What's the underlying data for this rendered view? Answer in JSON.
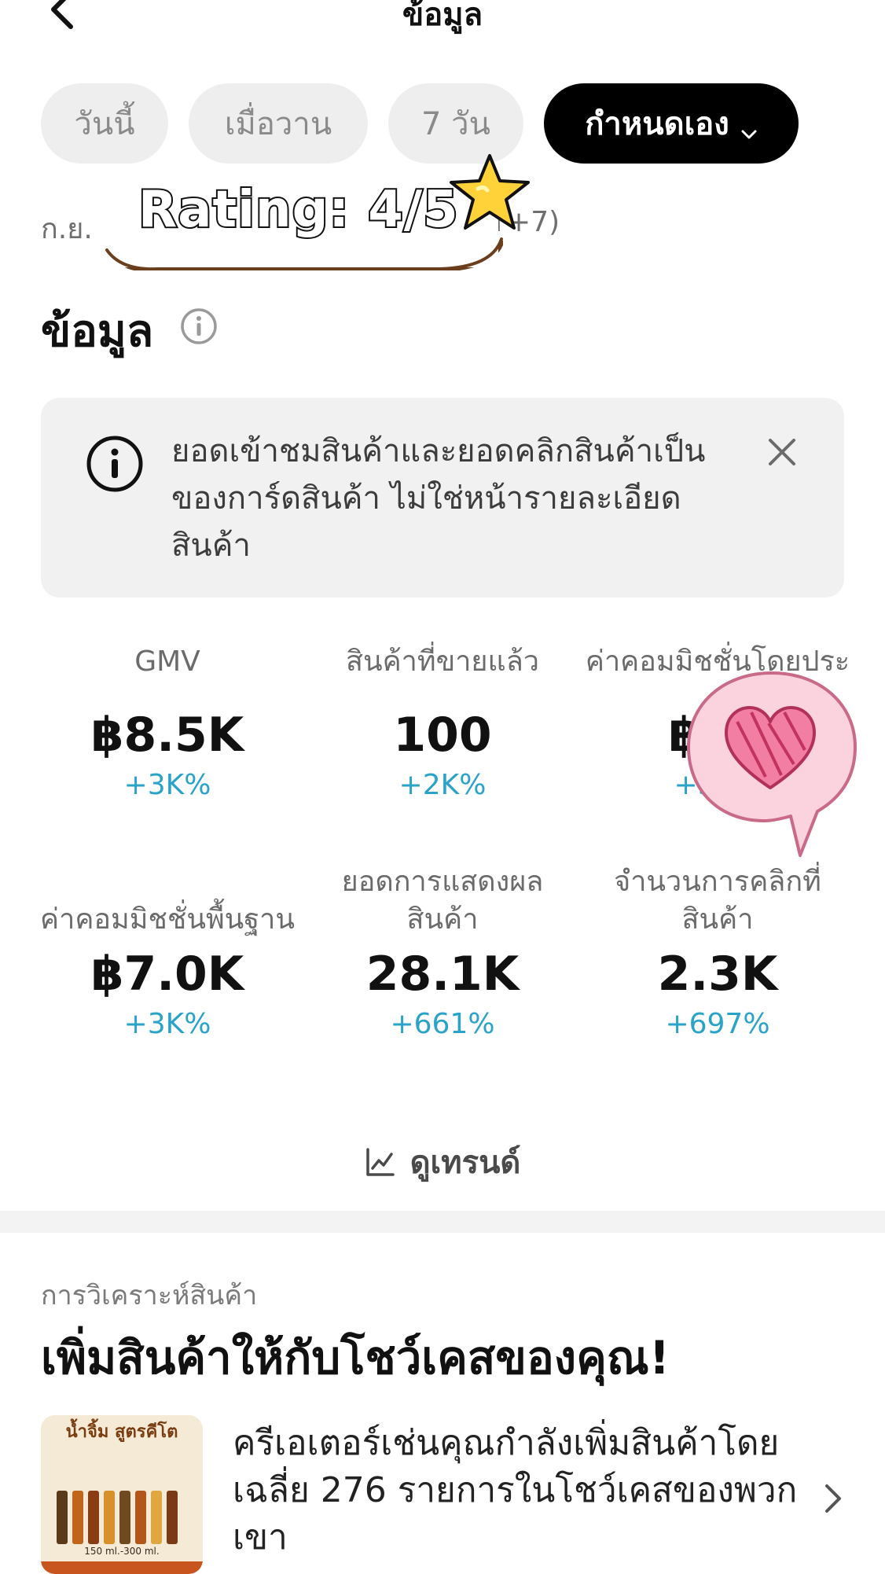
{
  "header": {
    "title": "ข้อมูล"
  },
  "chips": [
    {
      "label": "วันนี้",
      "active": false
    },
    {
      "label": "เมื่อวาน",
      "active": false
    },
    {
      "label": "7 วัน",
      "active": false
    },
    {
      "label": "กำหนดเอง",
      "active": true
    }
  ],
  "date_range": {
    "prefix": "ก.ย.",
    "suffix": "MT+7)"
  },
  "sticker": {
    "rating_text": "Rating: 4/5"
  },
  "section": {
    "title": "ข้อมูล"
  },
  "info_box": {
    "text": "ยอดเข้าชมสินค้าและยอดคลิกสินค้าเป็นของการ์ดสินค้า ไม่ใช่หน้ารายละเอียดสินค้า"
  },
  "metrics": [
    {
      "label": "GMV",
      "value": "฿8.5K",
      "change": "+3K%"
    },
    {
      "label": "สินค้าที่ขายแล้ว",
      "value": "100",
      "change": "+2K%"
    },
    {
      "label": "ค่าคอมมิชชั่นโดยประ",
      "value": "฿52",
      "change": "+3K%"
    },
    {
      "label": "ค่าคอมมิชชั่นพื้นฐาน",
      "value": "฿7.0K",
      "change": "+3K%"
    },
    {
      "label": "ยอดการแสดงผลสินค้า",
      "value": "28.1K",
      "change": "+661%"
    },
    {
      "label": "จำนวนการคลิกที่สินค้า",
      "value": "2.3K",
      "change": "+697%"
    }
  ],
  "trend": {
    "label": "ดูเทรนด์"
  },
  "analysis": {
    "subtitle": "การวิเคราะห์สินค้า",
    "title": "เพิ่มสินค้าให้กับโชว์เคสของคุณ!",
    "description": "ครีเอเตอร์เช่นคุณกำลังเพิ่มสินค้าโดยเฉลี่ย 276 รายการในโชว์เคสของพวกเขา",
    "product_image_title": "น้ำจิ้ม สูตรคีโต",
    "product_image_caption": "150 ml.-300 ml."
  },
  "colors": {
    "accent_change": "#29a3c7",
    "chip_active": "#000000",
    "chip_bg": "#eeeeee"
  }
}
